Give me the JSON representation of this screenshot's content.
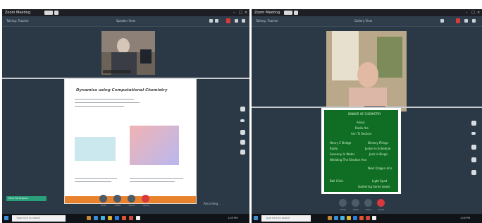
{
  "window": {
    "app_title": "Zoom Meeting"
  },
  "left_pane": {
    "toolbar_left": "Talking: Teacher",
    "toolbar_center": "Speaker View",
    "slide_title": "Dynamics using Computational Chemistry",
    "green_pill": "Dino Participant",
    "caption": "Recording..."
  },
  "right_pane": {
    "toolbar_left": "Talking: Teacher",
    "toolbar_center": "Gallery View",
    "board_lines": [
      "DINNER OF CHEMISTRY",
      "Alissa",
      "Radio Ale",
      "Ann Tt Sectors",
      "Henry C Bridge",
      "Dietary Pilings",
      "Radio",
      "Jackie in Schedule",
      "Sevenny In Water",
      "Jack In Bingo",
      "Wedding The Election Ann",
      "Next Dragon Ann",
      "Ball Clinic",
      "Light Sped",
      "Gathering Some Leads"
    ]
  },
  "controls": [
    "Mute",
    "Video",
    "Share",
    "Leave"
  ],
  "taskbar": {
    "search_placeholder": "Type here to search",
    "clock": "1:05 PM"
  },
  "colors": {
    "meeting_bg": "#2b3845",
    "leave_red": "#d9383d",
    "green_board": "#0f6e23",
    "slide_footer": "#e8822c"
  },
  "icons": [
    "mic-icon",
    "video-icon",
    "share-icon",
    "leave-icon",
    "windows-start-icon",
    "search-icon",
    "raise-hand-icon",
    "chat-icon"
  ]
}
